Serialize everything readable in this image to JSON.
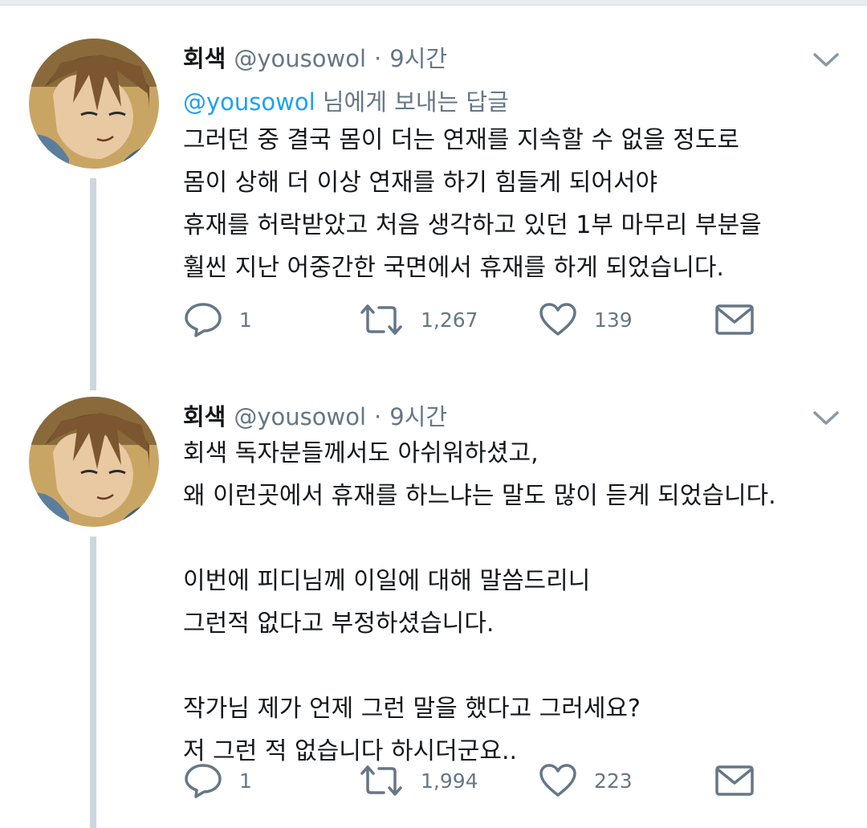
{
  "tweets": [
    {
      "author": "회색",
      "handle": "@yousowol",
      "separator": "·",
      "time": "9시간",
      "reply_to": {
        "mention": "@yousowol",
        "suffix": "님에게 보내는 답글"
      },
      "text": "그러던 중 결국 몸이 더는 연재를 지속할 수 없을 정도로\n몸이 상해 더 이상 연재를 하기 힘들게 되어서야\n휴재를 허락받았고 처음 생각하고 있던 1부 마무리 부분을\n훨씬 지난 어중간한 국면에서 휴재를 하게 되었습니다.",
      "actions": {
        "replies": "1",
        "retweets": "1,267",
        "likes": "139"
      }
    },
    {
      "author": "회색",
      "handle": "@yousowol",
      "separator": "·",
      "time": "9시간",
      "text": "회색 독자분들께서도 아쉬워하셨고,\n왜 이런곳에서 휴재를 하느냐는 말도 많이 듣게 되었습니다.\n\n이번에 피디님께 이일에 대해 말씀드리니\n그런적 없다고 부정하셨습니다.\n\n작가님 제가 언제 그런 말을 했다고 그러세요?\n저 그런 적 없습니다 하시더군요..",
      "actions": {
        "replies": "1",
        "retweets": "1,994",
        "likes": "223"
      }
    }
  ],
  "icons": {
    "reply": "reply-icon",
    "retweet": "retweet-icon",
    "like": "heart-icon",
    "dm": "envelope-icon",
    "more": "chevron-down-icon"
  },
  "colors": {
    "text": "#14171a",
    "secondary": "#657786",
    "link": "#1da1f2",
    "thread_line": "#ccd6dd"
  }
}
